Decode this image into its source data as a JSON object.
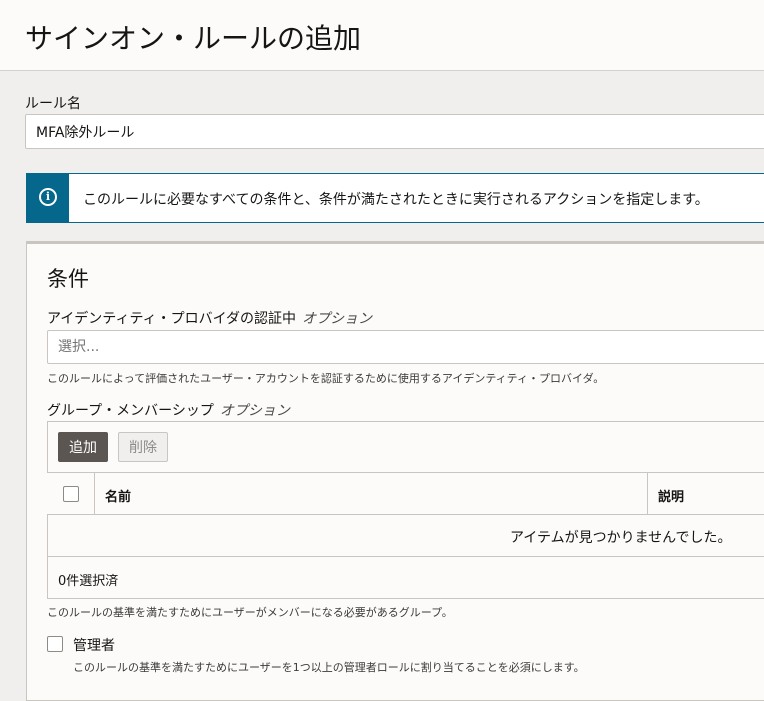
{
  "header": {
    "title": "サインオン・ルールの追加"
  },
  "rule_name": {
    "label": "ルール名",
    "value": "MFA除外ルール"
  },
  "info_banner": {
    "icon": "info-icon",
    "text": "このルールに必要なすべての条件と、条件が満たされたときに実行されるアクションを指定します。"
  },
  "conditions": {
    "title": "条件",
    "identity_provider": {
      "label": "アイデンティティ・プロバイダの認証中",
      "optional": "オプション",
      "placeholder": "選択...",
      "help": "このルールによって評価されたユーザー・アカウントを認証するために使用するアイデンティティ・プロバイダ。"
    },
    "group_membership": {
      "label": "グループ・メンバーシップ",
      "optional": "オプション",
      "add_button": "追加",
      "delete_button": "削除",
      "columns": [
        "名前",
        "説明"
      ],
      "empty_message": "アイテムが見つかりませんでした。",
      "selected_count": "0件選択済",
      "help": "このルールの基準を満たすためにユーザーがメンバーになる必要があるグループ。"
    },
    "administrator": {
      "label": "管理者",
      "checked": false,
      "help": "このルールの基準を満たすためにユーザーを1つ以上の管理者ロールに割り当てることを必須にします。"
    }
  },
  "colors": {
    "accent": "#04678b",
    "primary_button": "#5b5652",
    "background": "#f1efed"
  }
}
